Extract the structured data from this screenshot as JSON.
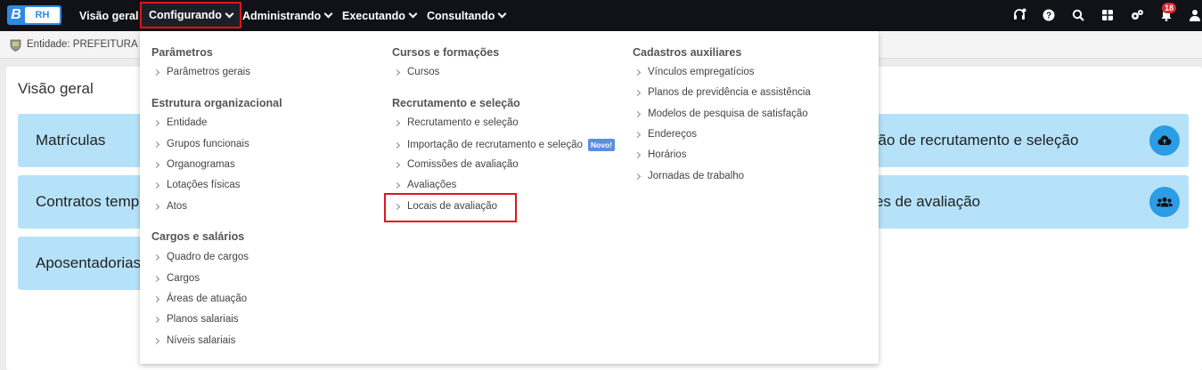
{
  "logo": {
    "letter": "B",
    "app": "RH"
  },
  "nav": {
    "visao_geral": "Visão geral",
    "configurando": "Configurando",
    "administrando": "Administrando",
    "executando": "Executando",
    "consultando": "Consultando"
  },
  "notifications": {
    "count": "18"
  },
  "icons": [
    "headset-icon",
    "help-icon",
    "search-icon",
    "apps-grid-icon",
    "settings-icon",
    "bell-icon",
    "user-icon"
  ],
  "entity": {
    "label": "Entidade: PREFEITURA D"
  },
  "overview": {
    "title": "Visão geral",
    "cards": [
      {
        "left": "Matrículas",
        "right": "ção de recrutamento e seleção",
        "icon": "cloud-upload-icon"
      },
      {
        "left": "Contratos temp",
        "right": "es de avaliação",
        "icon": "users-group-icon"
      },
      {
        "left": "Aposentadorias",
        "right": "",
        "icon": ""
      }
    ]
  },
  "menu": {
    "col1": {
      "parametros": {
        "title": "Parâmetros",
        "items": [
          "Parâmetros gerais"
        ]
      },
      "estrutura": {
        "title": "Estrutura organizacional",
        "items": [
          "Entidade",
          "Grupos funcionais",
          "Organogramas",
          "Lotações físicas",
          "Atos"
        ]
      },
      "cargos": {
        "title": "Cargos e salários",
        "items": [
          "Quadro de cargos",
          "Cargos",
          "Áreas de atuação",
          "Planos salariais",
          "Níveis salariais"
        ]
      }
    },
    "col2": {
      "cursos": {
        "title": "Cursos e formações",
        "items": [
          "Cursos"
        ]
      },
      "recrutamento": {
        "title": "Recrutamento e seleção",
        "items": [
          "Recrutamento e seleção",
          "Importação de recrutamento e seleção",
          "Comissões de avaliação",
          "Avaliações",
          "Locais de avaliação"
        ],
        "new_badge": "Novo!"
      }
    },
    "col3": {
      "cadastros": {
        "title": "Cadastros auxiliares",
        "items": [
          "Vínculos empregatícios",
          "Planos de previdência e assistência",
          "Modelos de pesquisa de satisfação",
          "Endereços",
          "Horários",
          "Jornadas de trabalho"
        ]
      }
    }
  },
  "colors": {
    "topbar": "#111118",
    "accent": "#2f8be0",
    "card": "#b6e2f9",
    "highlight": "#e0141c",
    "badge": "#e0262d"
  }
}
